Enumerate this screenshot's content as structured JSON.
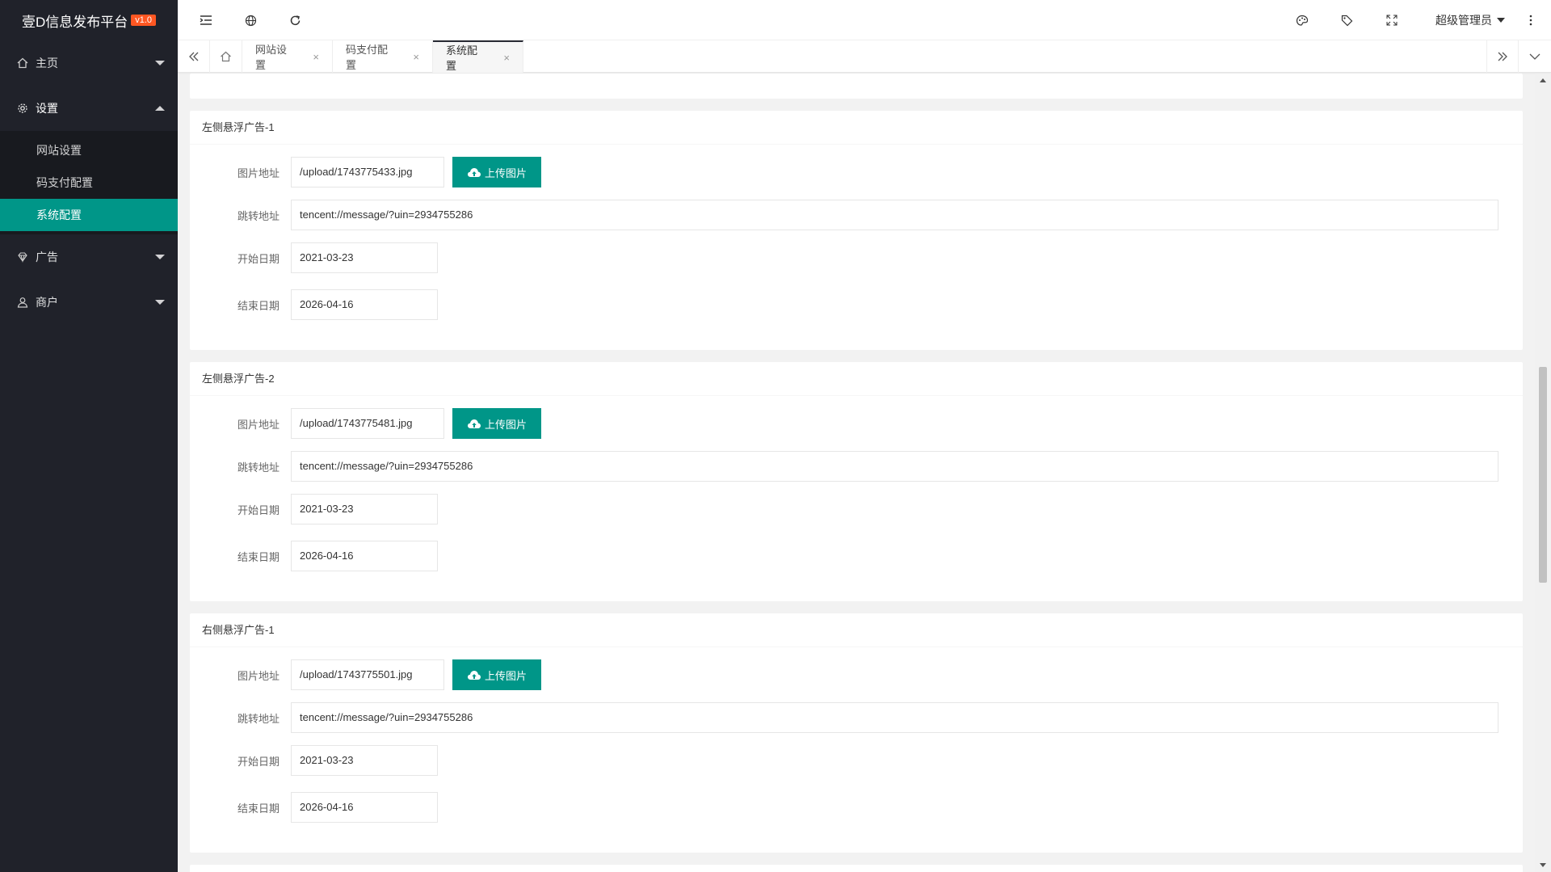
{
  "app": {
    "title": "壹D信息发布平台",
    "version": "v1.0"
  },
  "sidebar": {
    "items": [
      {
        "label": "主页",
        "icon": "home-icon"
      },
      {
        "label": "设置",
        "icon": "gear-icon"
      },
      {
        "label": "广告",
        "icon": "diamond-icon"
      },
      {
        "label": "商户",
        "icon": "user-icon"
      }
    ],
    "settings_sub": [
      "网站设置",
      "码支付配置",
      "系统配置"
    ]
  },
  "header": {
    "user": "超级管理员"
  },
  "tabs": [
    {
      "label": "网站设置"
    },
    {
      "label": "码支付配置"
    },
    {
      "label": "系统配置"
    }
  ],
  "labels": {
    "image": "图片地址",
    "link": "跳转地址",
    "start": "开始日期",
    "end": "结束日期",
    "upload": "上传图片"
  },
  "cards": [
    {
      "title": "左侧悬浮广告-1",
      "image": "/upload/1743775433.jpg",
      "link": "tencent://message/?uin=2934755286",
      "start": "2021-03-23",
      "end": "2026-04-16"
    },
    {
      "title": "左侧悬浮广告-2",
      "image": "/upload/1743775481.jpg",
      "link": "tencent://message/?uin=2934755286",
      "start": "2021-03-23",
      "end": "2026-04-16"
    },
    {
      "title": "右侧悬浮广告-1",
      "image": "/upload/1743775501.jpg",
      "link": "tencent://message/?uin=2934755286",
      "start": "2021-03-23",
      "end": "2026-04-16"
    }
  ],
  "colors": {
    "accent": "#009688",
    "sidebar": "#20222a",
    "badge": "#ff5722"
  }
}
